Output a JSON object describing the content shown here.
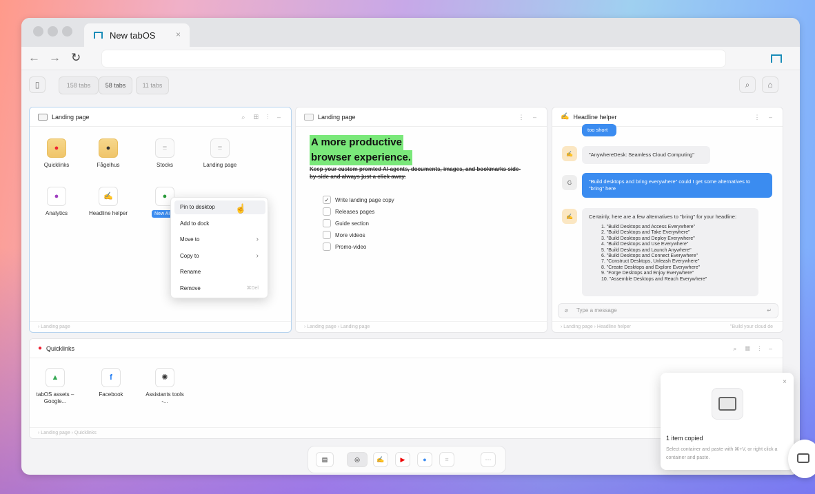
{
  "tab": {
    "title": "New tabOS",
    "close": "×"
  },
  "toolbar": {
    "tabs": [
      "158 tabs",
      "58 tabs",
      "11 tabs"
    ]
  },
  "panel1": {
    "title": "Landing page",
    "breadcrumb": "› Landing page",
    "items": [
      {
        "label": "Quicklinks"
      },
      {
        "label": "Fågelhus"
      },
      {
        "label": "Stocks"
      },
      {
        "label": "Landing page"
      },
      {
        "label": "Analytics"
      },
      {
        "label": "Headline helper"
      },
      {
        "label": "New AI ..."
      }
    ]
  },
  "menu": {
    "items": [
      "Pin to desktop",
      "Add to dock",
      "Move to",
      "Copy to",
      "Rename",
      "Remove"
    ],
    "remove_shortcut": "⌘Del",
    "sub_arrow": "›"
  },
  "panel2": {
    "title": "Landing page",
    "headline1": "A more productive",
    "headline2": "browser experience.",
    "strike": "Keep your custom promted AI-agents, documents, images, and bookmarks side-by-side and always just a click away.",
    "checklist": [
      {
        "label": "Write landing page copy",
        "checked": "✓"
      },
      {
        "label": "Releases pages",
        "checked": ""
      },
      {
        "label": "Guide section",
        "checked": ""
      },
      {
        "label": "More videos",
        "checked": ""
      },
      {
        "label": "Promo-video",
        "checked": ""
      }
    ],
    "breadcrumb": "› Landing page › Landing page"
  },
  "panel3": {
    "title": "Headline helper",
    "m0": "too short",
    "m1": "\"AnywhereDesk: Seamless Cloud Computing\"",
    "m2": "\"Build desktops and bring everywhere\" could I get some alternatives to \"bring\" here",
    "m3": "Certainly, here are a few alternatives to \"bring\" for your headline:",
    "list": [
      "1. \"Build Desktops and Access Everywhere\"",
      "2. \"Build Desktops and Take Everywhere\"",
      "3. \"Build Desktops and Deploy Everywhere\"",
      "4. \"Build Desktops and Use Everywhere\"",
      "5. \"Build Desktops and Launch Anywhere\"",
      "6. \"Build Desktops and Connect Everywhere\"",
      "7. \"Construct Desktops, Unleash Everywhere\"",
      "8. \"Create Desktops and Explore Everywhere\"",
      "9. \"Forge Desktops and Enjoy Everywhere\"",
      "10. \"Assemble Desktops and Reach Everywhere\""
    ],
    "avatar_user": "G",
    "placeholder": "Type a message",
    "breadcrumb": "› Landing page › Headline helper",
    "footer_right": "\"Build your cloud de"
  },
  "panel4": {
    "title": "Quicklinks",
    "items": [
      {
        "label": "tabOS assets – Google..."
      },
      {
        "label": "Facebook"
      },
      {
        "label": "Assistants tools -..."
      }
    ],
    "breadcrumb": "› Landing page › Quicklinks"
  },
  "toast": {
    "title": "1 item copied",
    "body": "Select container and paste with ⌘+V, or right click a container and paste.",
    "close": "×"
  },
  "dock": {
    "more": "···"
  }
}
